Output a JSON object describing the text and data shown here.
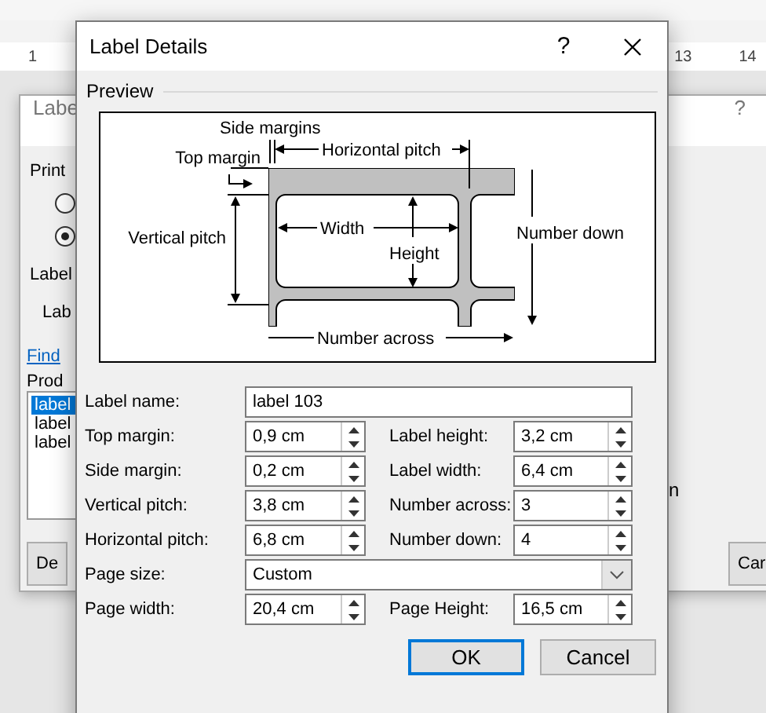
{
  "app": {
    "ruler_numbers": [
      "1",
      "13",
      "14"
    ]
  },
  "back_dialog": {
    "title": "Labe",
    "help": "?",
    "printer_heading": "Print",
    "radios": [
      {
        "selected": false
      },
      {
        "selected": true
      }
    ],
    "label_heading": "Label",
    "label_text": "Lab",
    "link": "Find",
    "products_heading": "Prod",
    "products": [
      {
        "text": "label",
        "selected": true
      },
      {
        "text": "label",
        "selected": false
      },
      {
        "text": "label",
        "selected": false
      }
    ],
    "side_text": "n",
    "buttons": [
      "De",
      "Car"
    ]
  },
  "dialog": {
    "title": "Label Details",
    "help": "?",
    "preview_heading": "Preview",
    "diagram": {
      "side_margins": "Side margins",
      "top_margin": "Top margin",
      "horizontal_pitch": "Horizontal pitch",
      "vertical_pitch": "Vertical pitch",
      "width": "Width",
      "height": "Height",
      "number_down": "Number down",
      "number_across": "Number across"
    },
    "rows": [
      [
        {
          "label": "Label name:",
          "kind": "text",
          "value": "label 103"
        }
      ],
      [
        {
          "label": "Top margin:",
          "kind": "spin",
          "value": "0,9 cm"
        },
        {
          "label": "Label height:",
          "kind": "spin",
          "value": "3,2 cm"
        }
      ],
      [
        {
          "label": "Side margin:",
          "kind": "spin",
          "value": "0,2 cm"
        },
        {
          "label": "Label width:",
          "kind": "spin",
          "value": "6,4 cm"
        }
      ],
      [
        {
          "label": "Vertical pitch:",
          "kind": "spin",
          "value": "3,8 cm"
        },
        {
          "label": "Number across:",
          "kind": "spin",
          "value": "3"
        }
      ],
      [
        {
          "label": "Horizontal pitch:",
          "kind": "spin",
          "value": "6,8 cm"
        },
        {
          "label": "Number down:",
          "kind": "spin",
          "value": "4"
        }
      ],
      [
        {
          "label": "Page size:",
          "kind": "dropdown",
          "value": "Custom"
        }
      ],
      [
        {
          "label": "Page width:",
          "kind": "spin",
          "value": "20,4 cm"
        },
        {
          "label": "Page Height:",
          "kind": "spin",
          "value": "16,5 cm"
        }
      ]
    ],
    "buttons": [
      {
        "label": "OK",
        "default": true
      },
      {
        "label": "Cancel",
        "default": false
      }
    ]
  }
}
